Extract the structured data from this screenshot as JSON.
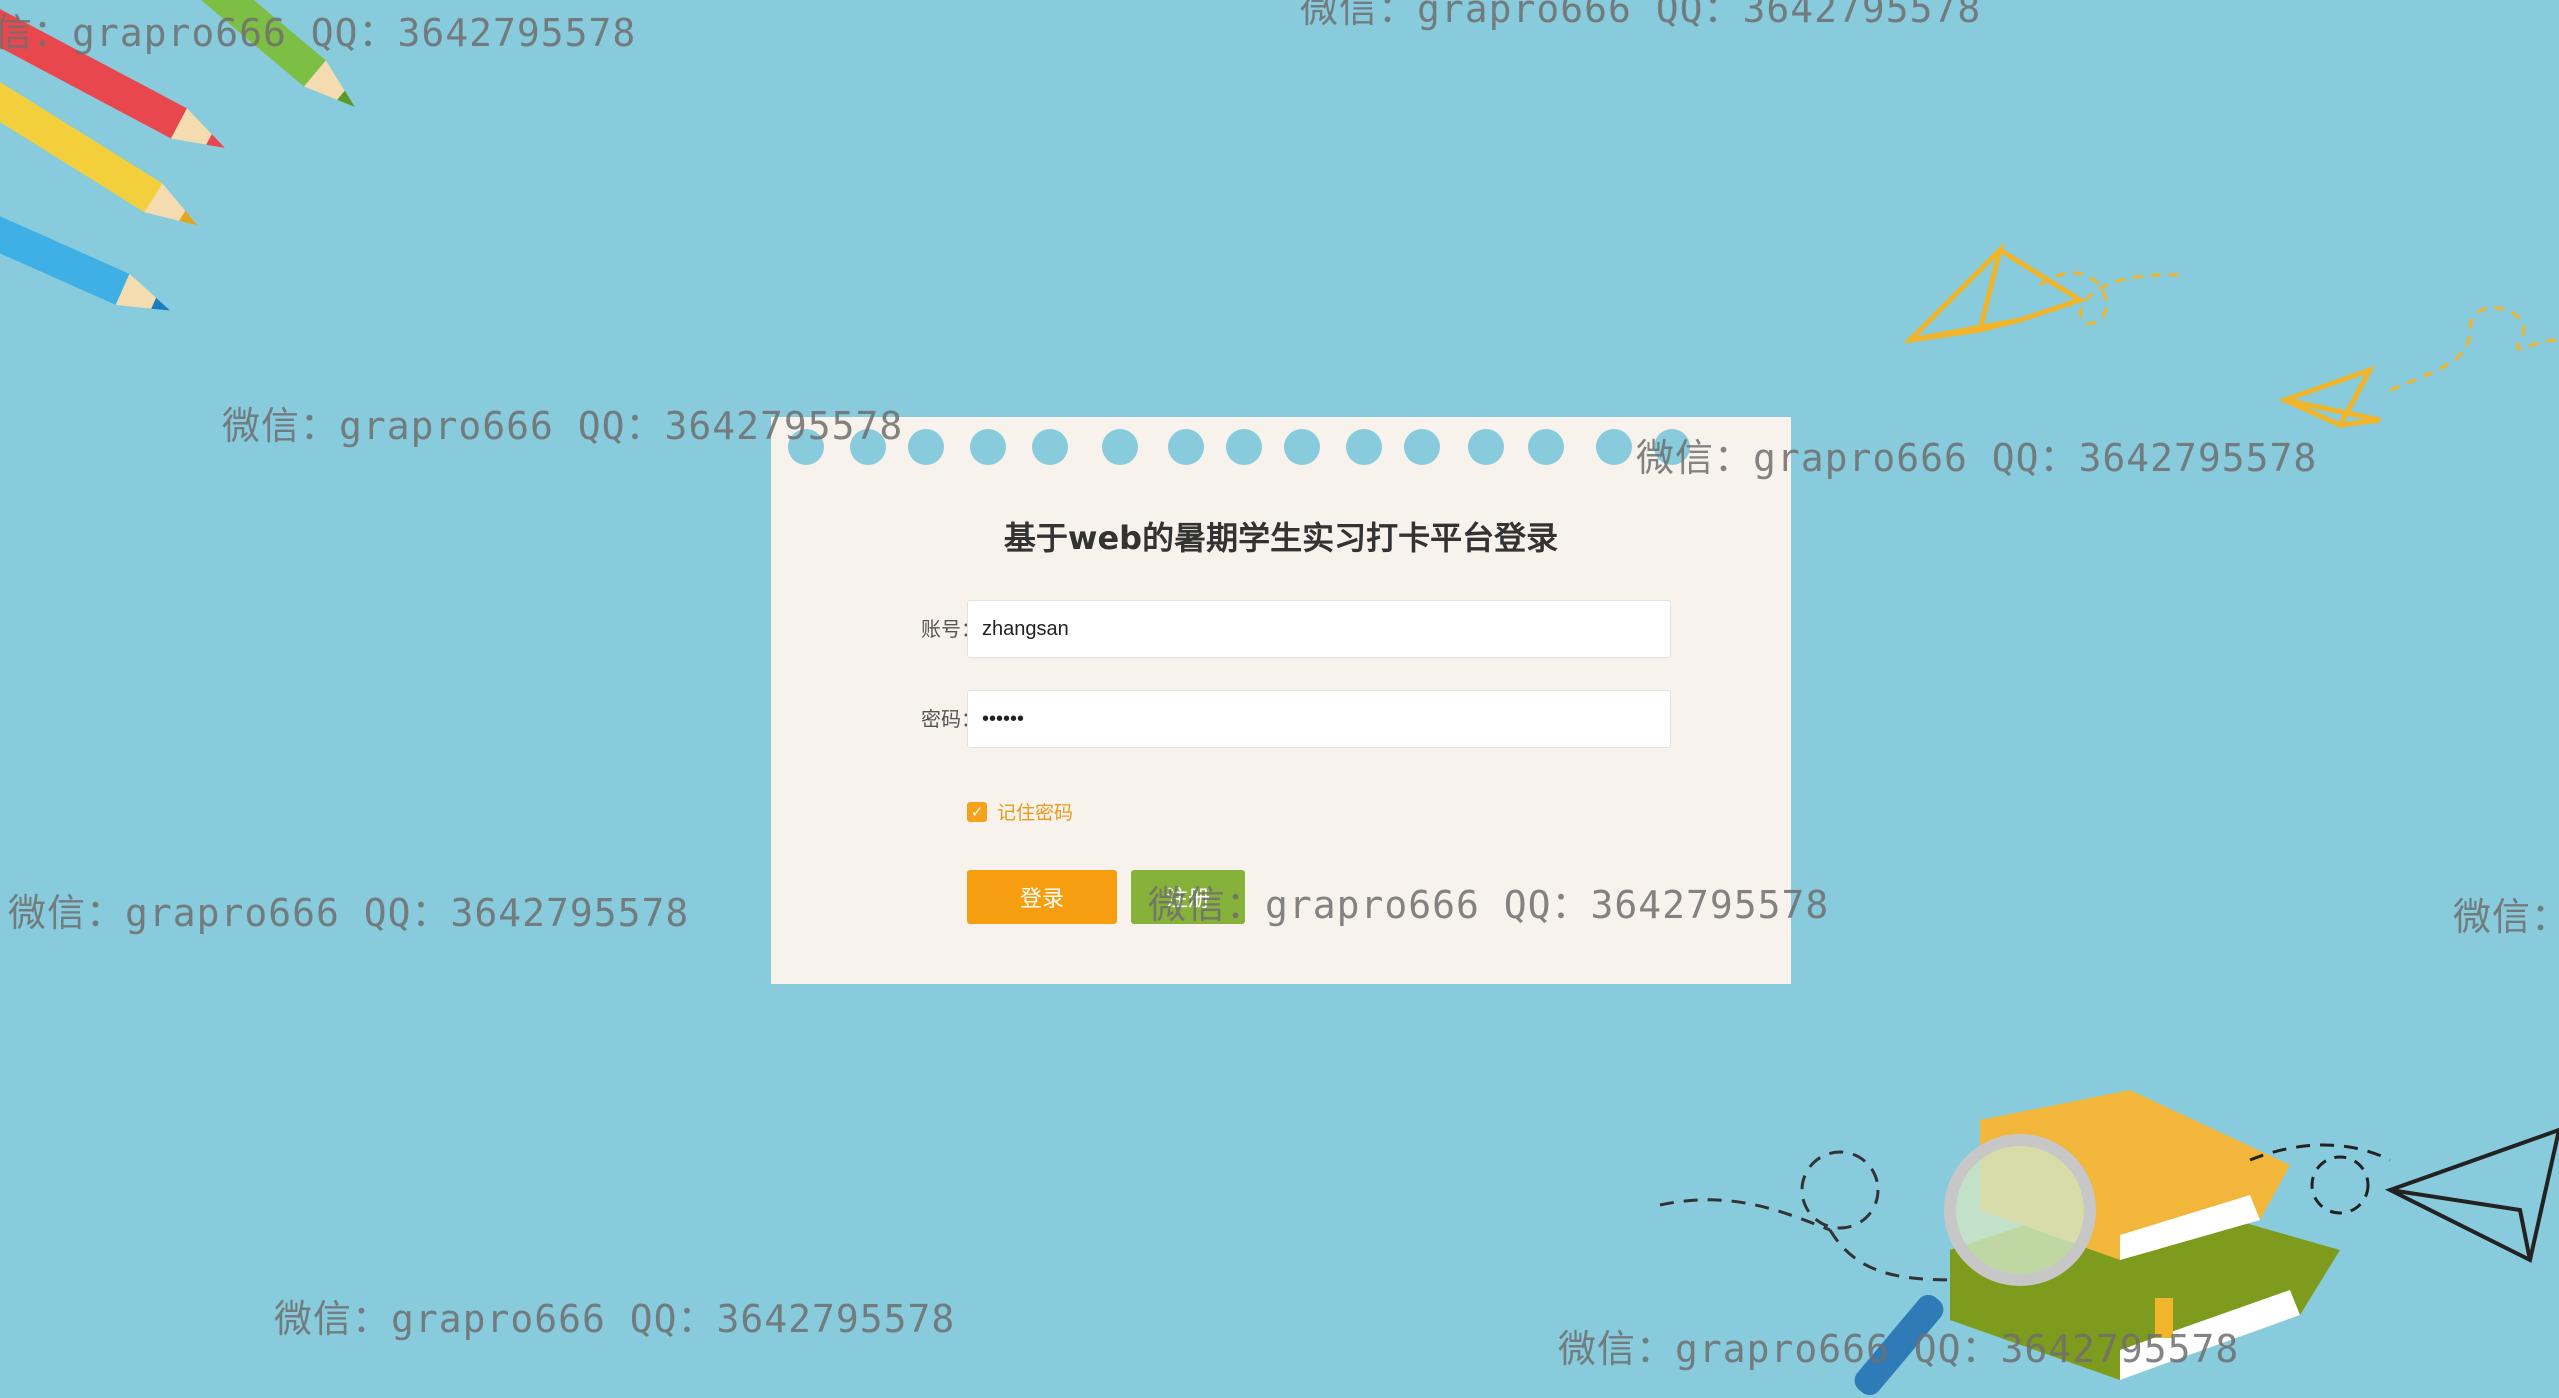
{
  "login": {
    "title": "基于web的暑期学生实习打卡平台登录",
    "username_label": "账号：",
    "username_value": "zhangsan",
    "password_label": "密码：",
    "password_value": "••••••",
    "remember_label": "记住密码",
    "remember_checked": true,
    "login_button": "登录",
    "register_button": "注册"
  },
  "watermark": {
    "text": "微信：grapro666 QQ：3642795578",
    "top_left_partial": "信：grapro666 QQ：3642795578",
    "top_center_partial": "微信：grapro666 QQ：3642795578",
    "right_partial": "微信："
  },
  "colors": {
    "background": "#88cbdc",
    "card": "#f8f2ec",
    "login_button": "#f79d10",
    "register_button": "#86b13a",
    "accent": "#e79c1b"
  }
}
